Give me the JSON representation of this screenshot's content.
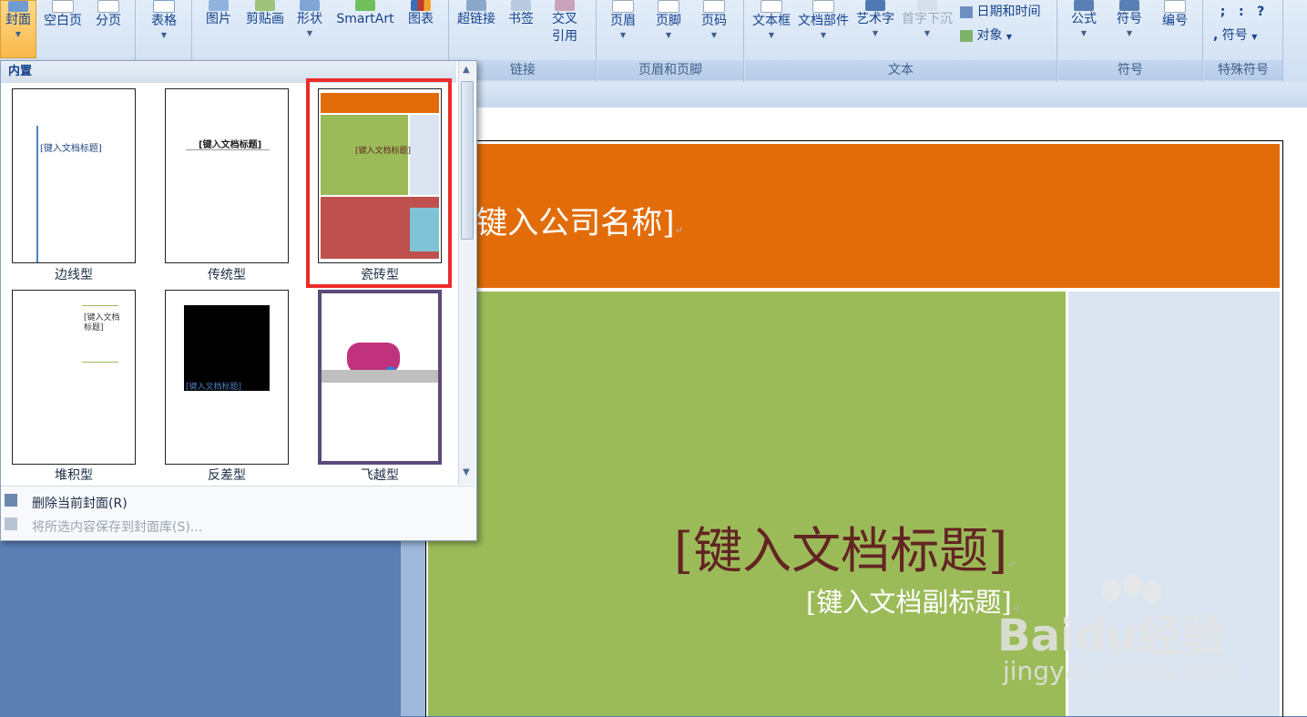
{
  "ribbon": {
    "buttons": {
      "cover": "封面",
      "blank_page": "空白页",
      "page_break": "分页",
      "table": "表格",
      "picture": "图片",
      "clipart": "剪贴画",
      "shapes": "形状",
      "smartart": "SmartArt",
      "chart": "图表",
      "hyperlink": "超链接",
      "bookmark": "书签",
      "cross_ref_1": "交叉",
      "cross_ref_2": "引用",
      "header": "页眉",
      "footer": "页脚",
      "page_number": "页码",
      "textbox": "文本框",
      "quick_parts": "文档部件",
      "wordart": "艺术字",
      "drop_cap": "首字下沉",
      "date_time": "日期和时间",
      "object": "对象",
      "equation": "公式",
      "symbol": "符号",
      "numbering": "编号",
      "special_symbol": "符号"
    },
    "groups": {
      "links": "链接",
      "header_footer": "页眉和页脚",
      "text": "文本",
      "symbols": "符号",
      "special_symbols": "特殊符号"
    }
  },
  "gallery": {
    "header": "内置",
    "items": [
      {
        "label": "边线型"
      },
      {
        "label": "传统型"
      },
      {
        "label": "瓷砖型"
      },
      {
        "label": "堆积型"
      },
      {
        "label": "反差型"
      },
      {
        "label": "飞越型"
      }
    ],
    "menu": {
      "remove": "删除当前封面(R)",
      "save": "将所选内容保存到封面库(S)..."
    }
  },
  "thumb_text": {
    "doc_title": "[键入文档标题]",
    "doc_title_2": "[键入文档",
    "doc_title_3": "标题]"
  },
  "document": {
    "company": "[键入公司名称]",
    "title": "[键入文档标题]",
    "subtitle": "[键入文档副标题]",
    "paragraph_mark": "↵"
  },
  "watermark": {
    "brand": "Baidu经验",
    "url": "jingyan.baidu.com"
  },
  "colors": {
    "orange": "#e36c0a",
    "green": "#9bbb59",
    "light_blue": "#dbe5f1",
    "title_red": "#632523",
    "highlight": "#ec2b2b"
  }
}
